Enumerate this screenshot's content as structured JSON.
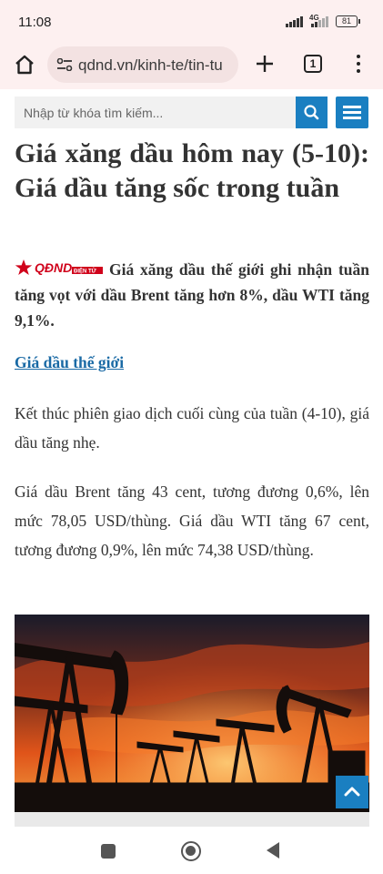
{
  "status": {
    "time": "11:08",
    "network": "4G",
    "battery": "81"
  },
  "browser": {
    "url": "qdnd.vn/kinh-te/tin-tu",
    "tab_count": "1"
  },
  "search": {
    "placeholder": "Nhập từ khóa tìm kiếm..."
  },
  "article": {
    "title": "Giá xăng dầu hôm nay (5-10): Giá dầu tăng sốc trong tuần",
    "logo_text": "QĐND",
    "logo_sub": "ĐIỆN TỬ",
    "lead": "Giá xăng dầu thế giới ghi nhận tuần tăng vọt với dầu Brent tăng hơn 8%, dầu WTI tăng 9,1%.",
    "tag": "Giá dầu thế giới",
    "paragraphs": [
      "Kết thúc phiên giao dịch cuối cùng của tuần (4-10), giá dầu tăng nhẹ.",
      "Giá dầu Brent tăng 43 cent, tương đương 0,6%, lên mức 78,05 USD/thùng. Giá dầu WTI tăng 67 cent, tương đương 0,9%, lên mức 74,38 USD/thùng."
    ]
  },
  "colors": {
    "accent": "#1a7fc1",
    "link": "#1a6aa5",
    "browser_bg": "#fdf0f0",
    "logo_red": "#d0021b"
  },
  "icons": {
    "home": "home-icon",
    "site_settings": "tune-icon",
    "new_tab": "plus-icon",
    "tabs": "tab-switcher-icon",
    "overflow": "more-vert-icon",
    "search": "search-icon",
    "menu": "hamburger-icon",
    "scroll_top": "chevron-up-icon"
  }
}
